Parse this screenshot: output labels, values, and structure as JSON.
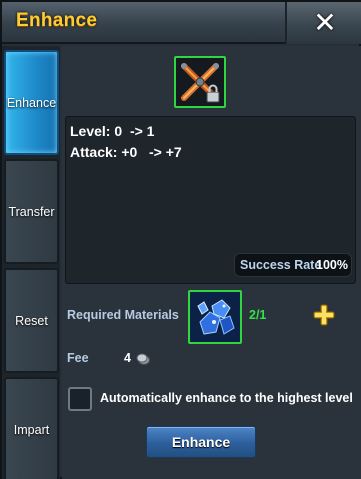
{
  "header": {
    "title": "Enhance",
    "close_icon": "close-icon",
    "title_color": "#ffcc33"
  },
  "sidebar": {
    "tabs": [
      {
        "label": "Enhance",
        "active": true
      },
      {
        "label": "Transfer",
        "active": false
      },
      {
        "label": "Reset",
        "active": false
      },
      {
        "label": "Impart",
        "active": false
      }
    ]
  },
  "item": {
    "icon": "crossed-weapons-icon",
    "locked": true,
    "rarity_color": "#2fd641"
  },
  "stats": {
    "level": {
      "label": "Level:",
      "from": "0",
      "arrow": "->",
      "to": "1"
    },
    "attack": {
      "label": "Attack:",
      "from": "+0",
      "arrow": "->",
      "to": "+7"
    },
    "success_rate_label": "Success Rate",
    "success_rate_value": "100%"
  },
  "materials": {
    "label": "Required Materials",
    "icon": "blue-crystal-icon",
    "count": "2/1",
    "add_icon": "plus-icon"
  },
  "fee": {
    "label": "Fee",
    "value": "4",
    "icon": "coin-icon"
  },
  "auto_enhance": {
    "checked": false,
    "label": "Automatically enhance to the highest level"
  },
  "actions": {
    "enhance_label": "Enhance"
  }
}
